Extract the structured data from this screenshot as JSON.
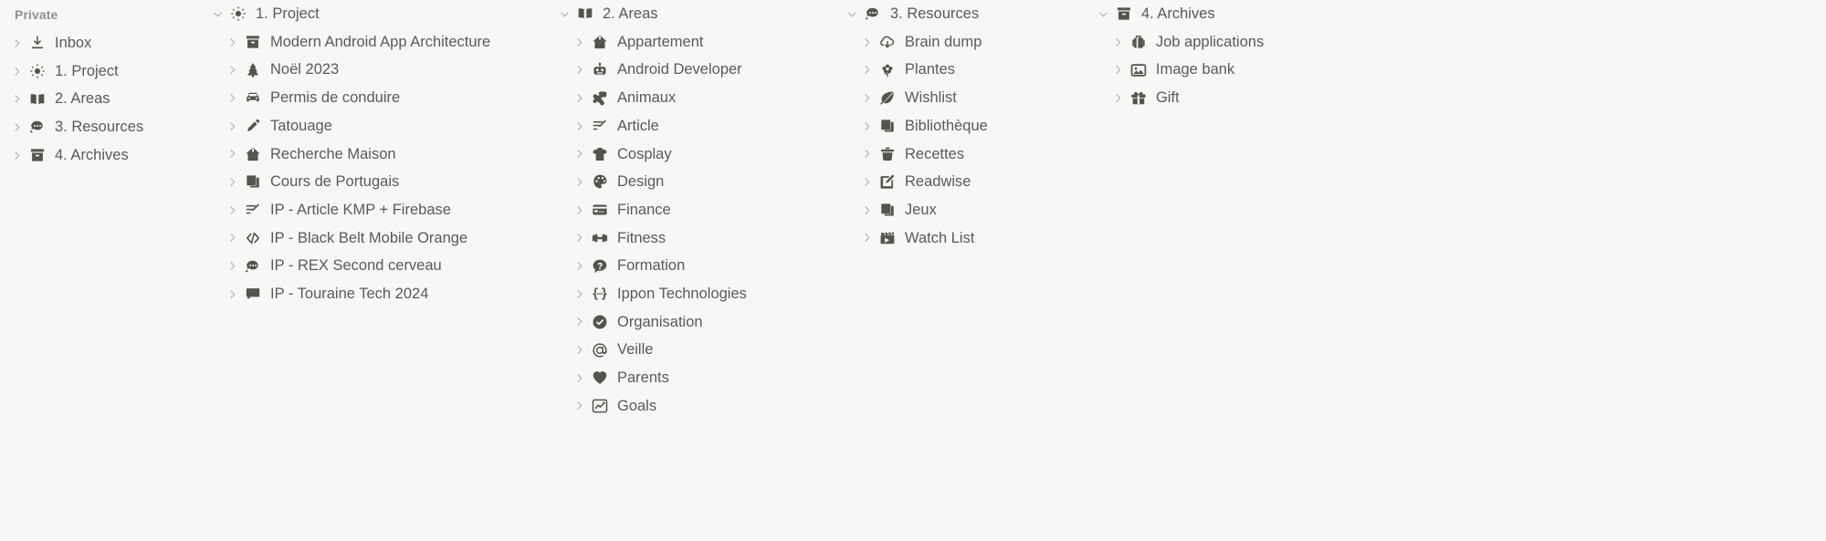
{
  "sidebar": {
    "section_label": "Private",
    "items": [
      {
        "label": "Inbox",
        "icon": "inbox-download-icon",
        "expanded": false
      },
      {
        "label": "1. Project",
        "icon": "sun-icon",
        "expanded": false
      },
      {
        "label": "2. Areas",
        "icon": "open-book-icon",
        "expanded": false
      },
      {
        "label": "3. Resources",
        "icon": "thought-bubble-icon",
        "expanded": false
      },
      {
        "label": "4. Archives",
        "icon": "archive-box-icon",
        "expanded": false
      }
    ]
  },
  "columns": [
    {
      "id": "project",
      "header": {
        "label": "1. Project",
        "icon": "sun-icon",
        "expanded": true
      },
      "children": [
        {
          "label": "Modern Android App Architecture",
          "icon": "archive-box-icon"
        },
        {
          "label": "Noël 2023",
          "icon": "christmas-tree-icon"
        },
        {
          "label": "Permis de conduire",
          "icon": "car-icon"
        },
        {
          "label": "Tatouage",
          "icon": "pencil-icon"
        },
        {
          "label": "Recherche Maison",
          "icon": "house-icon"
        },
        {
          "label": "Cours de Portugais",
          "icon": "books-icon"
        },
        {
          "label": "IP - Article KMP + Firebase",
          "icon": "edit-list-icon"
        },
        {
          "label": "IP - Black Belt Mobile Orange",
          "icon": "code-brackets-icon"
        },
        {
          "label": "IP - REX Second cerveau",
          "icon": "thought-bubble-icon"
        },
        {
          "label": "IP - Touraine Tech 2024",
          "icon": "speech-bubble-icon"
        }
      ]
    },
    {
      "id": "areas",
      "header": {
        "label": "2. Areas",
        "icon": "open-book-icon",
        "expanded": true
      },
      "children": [
        {
          "label": "Appartement",
          "icon": "house-icon"
        },
        {
          "label": "Android Developer",
          "icon": "robot-icon"
        },
        {
          "label": "Animaux",
          "icon": "bone-icon"
        },
        {
          "label": "Article",
          "icon": "edit-list-icon"
        },
        {
          "label": "Cosplay",
          "icon": "tshirt-icon"
        },
        {
          "label": "Design",
          "icon": "palette-icon"
        },
        {
          "label": "Finance",
          "icon": "credit-card-icon"
        },
        {
          "label": "Fitness",
          "icon": "dumbbell-icon"
        },
        {
          "label": "Formation",
          "icon": "question-bubble-icon"
        },
        {
          "label": "Ippon Technologies",
          "icon": "curly-braces-icon"
        },
        {
          "label": "Organisation",
          "icon": "check-circle-icon"
        },
        {
          "label": "Veille",
          "icon": "at-sign-icon"
        },
        {
          "label": "Parents",
          "icon": "heart-icon"
        },
        {
          "label": "Goals",
          "icon": "chart-line-icon"
        }
      ]
    },
    {
      "id": "resources",
      "header": {
        "label": "3. Resources",
        "icon": "thought-bubble-icon",
        "expanded": true
      },
      "children": [
        {
          "label": "Brain dump",
          "icon": "cloud-download-icon"
        },
        {
          "label": "Plantes",
          "icon": "flower-icon"
        },
        {
          "label": "Wishlist",
          "icon": "leaf-icon"
        },
        {
          "label": "Bibliothèque",
          "icon": "books-icon"
        },
        {
          "label": "Recettes",
          "icon": "trash-icon"
        },
        {
          "label": "Readwise",
          "icon": "edit-square-icon"
        },
        {
          "label": "Jeux",
          "icon": "book-closed-icon"
        },
        {
          "label": "Watch List",
          "icon": "clapperboard-icon"
        }
      ]
    },
    {
      "id": "archives",
      "header": {
        "label": "4. Archives",
        "icon": "archive-box-icon",
        "expanded": true
      },
      "children": [
        {
          "label": "Job applications",
          "icon": "briefcase-icon"
        },
        {
          "label": "Image bank",
          "icon": "image-icon"
        },
        {
          "label": "Gift",
          "icon": "gift-icon"
        }
      ]
    }
  ],
  "colors": {
    "background": "#f7f7f5",
    "text": "#5b5a57",
    "muted": "#91918e",
    "icon": "#55534e",
    "twisty": "#b4b3ae"
  }
}
